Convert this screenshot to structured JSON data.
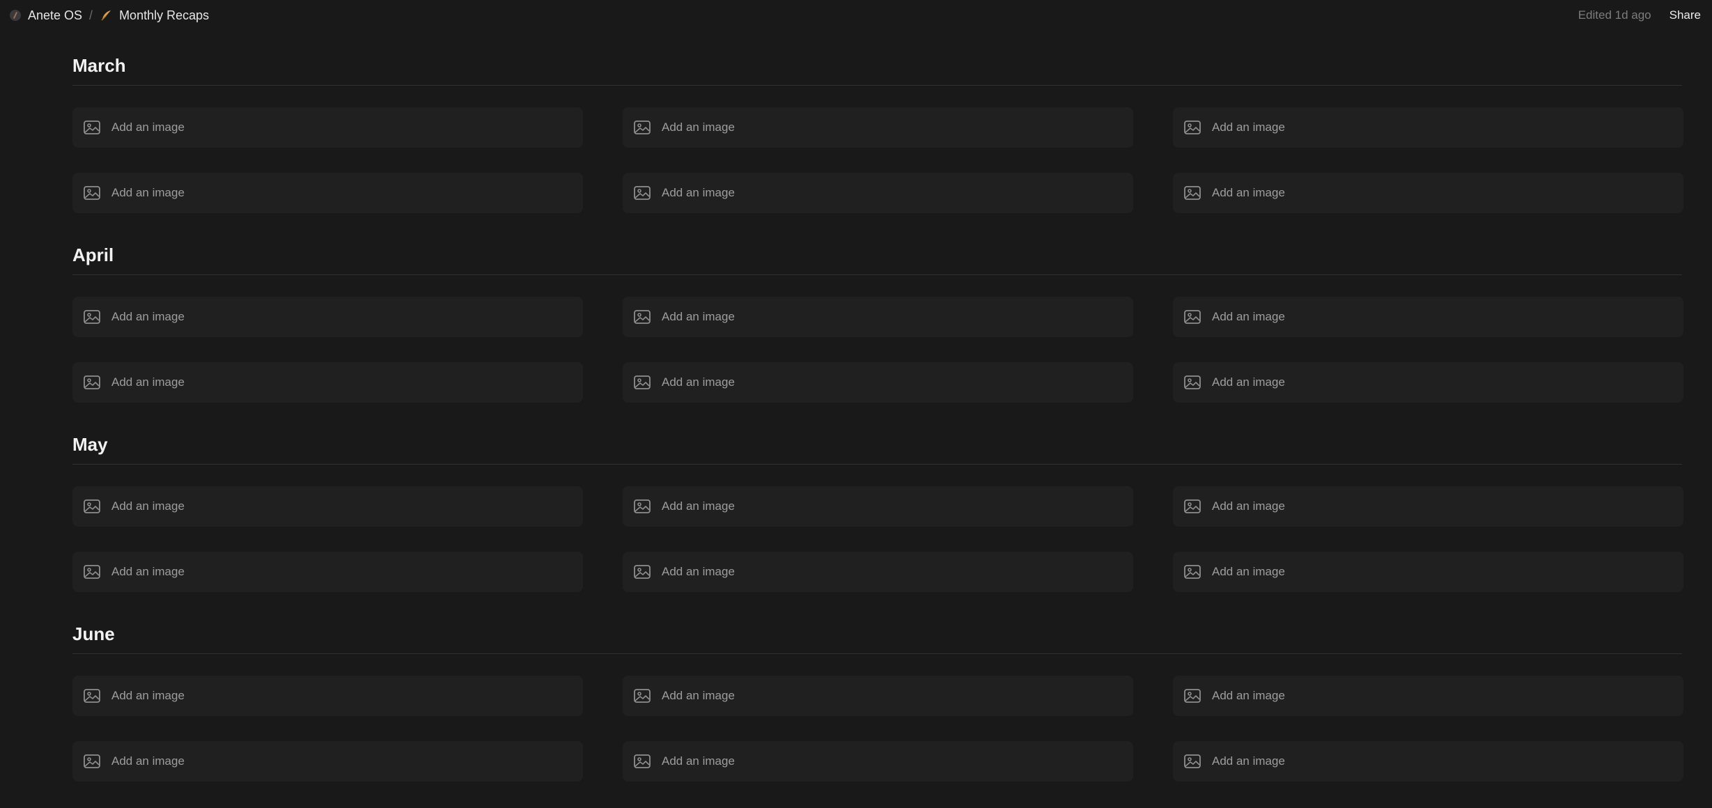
{
  "breadcrumb": {
    "workspace": "Anete OS",
    "separator": "/",
    "page": "Monthly Recaps"
  },
  "header": {
    "edited": "Edited 1d ago",
    "share_label": "Share"
  },
  "icons": {
    "workspace": "compass-icon",
    "page": "feather-icon",
    "tile": "image-icon"
  },
  "colors": {
    "background": "#191919",
    "tile": "#202020",
    "page_icon": "#d6a43b"
  },
  "placeholder": "Add an image",
  "sections": [
    {
      "title": "March",
      "tiles": [
        "Add an image",
        "Add an image",
        "Add an image",
        "Add an image",
        "Add an image",
        "Add an image"
      ]
    },
    {
      "title": "April",
      "tiles": [
        "Add an image",
        "Add an image",
        "Add an image",
        "Add an image",
        "Add an image",
        "Add an image"
      ]
    },
    {
      "title": "May",
      "tiles": [
        "Add an image",
        "Add an image",
        "Add an image",
        "Add an image",
        "Add an image",
        "Add an image"
      ]
    },
    {
      "title": "June",
      "tiles": [
        "Add an image",
        "Add an image",
        "Add an image",
        "Add an image",
        "Add an image",
        "Add an image"
      ]
    }
  ]
}
